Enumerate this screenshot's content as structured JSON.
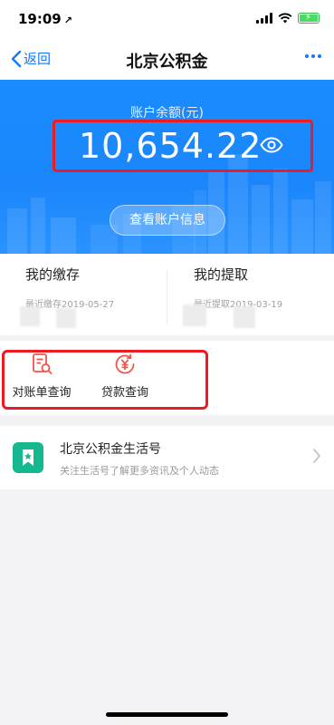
{
  "status_bar": {
    "time": "19:09",
    "location_glyph": "↗"
  },
  "nav": {
    "back_label": "返回",
    "title": "北京公积金"
  },
  "hero": {
    "balance_label": "账户余额(元)",
    "balance_value": "10,654.22",
    "view_account_button": "查看账户信息"
  },
  "summary": {
    "deposit": {
      "title": "我的缴存",
      "recent_label": "最近缴存",
      "date": "2019-05-27"
    },
    "withdrawal": {
      "title": "我的提取",
      "recent_label": "最近提取",
      "date": "2019-03-19"
    }
  },
  "quick_actions": [
    {
      "label": "对账单查询",
      "icon": "statement-search-icon"
    },
    {
      "label": "贷款查询",
      "icon": "loan-yuan-icon"
    }
  ],
  "life_account": {
    "title": "北京公积金生活号",
    "subtitle": "关注生活号了解更多资讯及个人动态"
  },
  "colors": {
    "accent": "#1677ff",
    "hero": "#1a8cff",
    "highlight": "#ec1c24",
    "icon_red": "#f05545",
    "life_green": "#14b78e"
  }
}
